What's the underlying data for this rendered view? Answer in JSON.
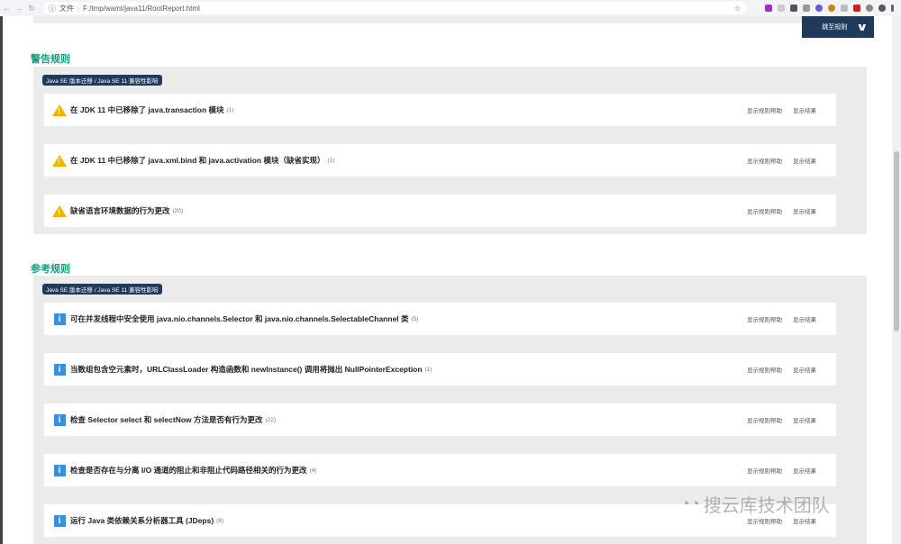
{
  "browser": {
    "file_label": "文件",
    "url": "F:/tmp/wamt/java11/RootReport.html"
  },
  "jump_button": "跳至规则",
  "sections": [
    {
      "heading": "警告规则",
      "badge": "Java SE 版本迁移 / Java SE 11 兼容性影响",
      "icon": "warning-icon",
      "rules": [
        {
          "title": "在 JDK 11 中已移除了 java.transaction 模块",
          "count": "(1)"
        },
        {
          "title": "在 JDK 11 中已移除了 java.xml.bind 和 java.activation 模块（缺省实现）",
          "count": "(1)"
        },
        {
          "title": "缺省语言环境数据的行为更改",
          "count": "(20)"
        }
      ]
    },
    {
      "heading": "参考规则",
      "badge": "Java SE 版本迁移 / Java SE 11 兼容性影响",
      "icon": "info-icon",
      "rules": [
        {
          "title": "可在并发线程中安全使用 java.nio.channels.Selector 和 java.nio.channels.SelectableChannel 类",
          "count": "(5)"
        },
        {
          "title": "当数组包含空元素时，URLClassLoader 构造函数和 newInstance() 调用将抛出 NullPointerException",
          "count": "(1)"
        },
        {
          "title": "检查 Selector select 和 selectNow 方法是否有行为更改",
          "count": "(22)"
        },
        {
          "title": "检查是否存在与分离 I/O 通道的阻止和非阻止代码路径相关的行为更改",
          "count": "(4)"
        },
        {
          "title": "运行 Java 类依赖关系分析器工具 (JDeps)",
          "count": "(8)"
        }
      ]
    }
  ],
  "links": {
    "help": "显示规则帮助",
    "results": "显示结果"
  },
  "watermark": "搜云库技术团队"
}
